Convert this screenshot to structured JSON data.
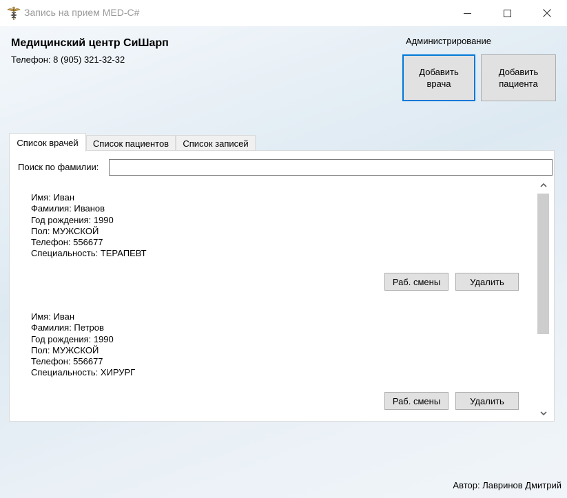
{
  "window": {
    "title": "Запись на прием MED-C#",
    "icon": "caduceus-icon",
    "controls": {
      "minimize": "minimize-icon",
      "maximize": "maximize-icon",
      "close": "close-icon"
    }
  },
  "header": {
    "clinic_name": "Медицинский центр СиШарп",
    "phone": "Телефон: 8 (905) 321-32-32"
  },
  "admin": {
    "label": "Администрирование",
    "add_doctor": "Добавить\nврача",
    "add_patient": "Добавить\nпациента"
  },
  "tabs": [
    {
      "label": "Список врачей",
      "active": true
    },
    {
      "label": "Список пациентов",
      "active": false
    },
    {
      "label": "Список записей",
      "active": false
    }
  ],
  "search": {
    "label": "Поиск по фамилии:",
    "value": "",
    "placeholder": ""
  },
  "doctors": [
    {
      "name": "Имя: Иван",
      "surname": "Фамилия: Иванов",
      "birth_year": "Год рождения: 1990",
      "gender": "Пол: МУЖСКОЙ",
      "phone": "Телефон: 556677",
      "specialty": "Специальность: ТЕРАПЕВТ",
      "shifts_label": "Раб. смены",
      "delete_label": "Удалить"
    },
    {
      "name": "Имя: Иван",
      "surname": "Фамилия: Петров",
      "birth_year": "Год рождения: 1990",
      "gender": "Пол: МУЖСКОЙ",
      "phone": "Телефон: 556677",
      "specialty": "Специальность: ХИРУРГ",
      "shifts_label": "Раб. смены",
      "delete_label": "Удалить"
    }
  ],
  "footer": {
    "author": "Автор: Лавринов Дмитрий"
  },
  "colors": {
    "focus_border": "#0078d7",
    "button_bg": "#e1e1e1"
  }
}
